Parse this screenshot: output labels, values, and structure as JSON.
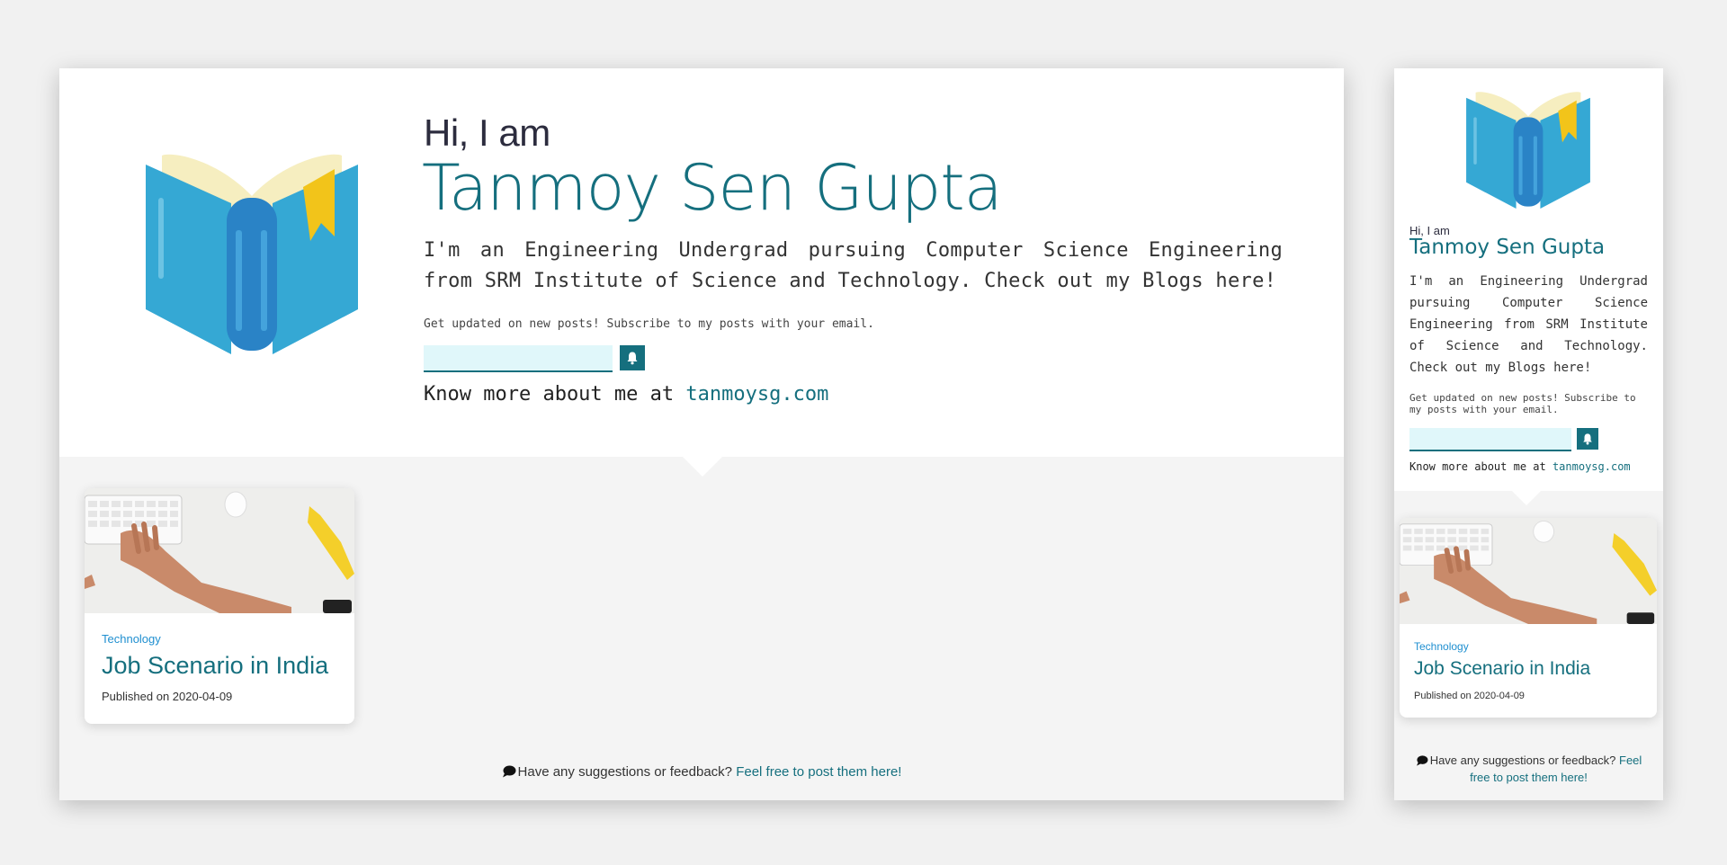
{
  "hero": {
    "greeting": "Hi, I am",
    "name": "Tanmoy Sen Gupta",
    "bio": "I'm an Engineering Undergrad pursuing Computer Science Engineering from SRM Institute of Science and Technology. Check out my Blogs here!",
    "subscribe_text": "Get updated on new posts! Subscribe to my posts with your email.",
    "email_value": "",
    "email_placeholder": "",
    "know_more_prefix": "Know more about me at ",
    "know_more_link": "tanmoysg.com",
    "icons": {
      "logo": "book-icon",
      "subscribe": "bell-icon"
    }
  },
  "posts": [
    {
      "category": "Technology",
      "title": "Job Scenario in India",
      "published": "Published on 2020-04-09",
      "image": "keyboard-desk-photo"
    }
  ],
  "footer": {
    "feedback_text": "Have any suggestions or feedback? ",
    "feedback_link": "Feel free to post them here!",
    "icon": "speech-bubble-icon"
  },
  "colors": {
    "accent": "#156f7e",
    "category_blue": "#1f8fd0",
    "input_bg": "#e0f7fa",
    "page_bg": "#f1f1f1"
  }
}
